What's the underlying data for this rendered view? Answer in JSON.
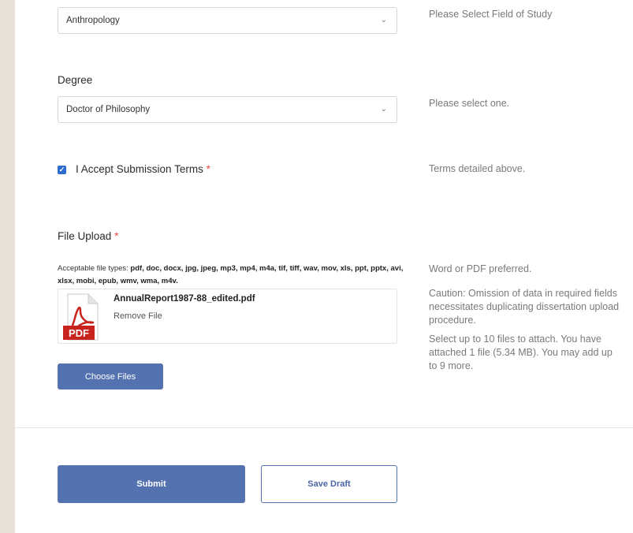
{
  "field_of_study": {
    "selected": "Anthropology",
    "help": "Please Select Field of Study"
  },
  "degree": {
    "label": "Degree",
    "selected": "Doctor of Philosophy",
    "help": "Please select one."
  },
  "terms": {
    "label": "I Accept Submission Terms",
    "required_mark": "*",
    "checked": true,
    "help": "Terms detailed above."
  },
  "file_upload": {
    "label": "File Upload",
    "required_mark": "*",
    "types_prefix": "Acceptable file types:",
    "types_list": "pdf, doc, docx, jpg, jpeg, mp3, mp4, m4a, tif, tiff, wav, mov, xls, ppt, pptx, avi, xlsx, mobi, epub, wmv, wma, m4v.",
    "file_name": "AnnualReport1987-88_edited.pdf",
    "remove_label": "Remove File",
    "file_icon_text": "PDF",
    "help_preferred": "Word or PDF preferred.",
    "help_caution": "Caution: Omission of data in required fields necessitates duplicating dissertation upload procedure.",
    "help_limit": "Select up to 10 files to attach. You have attached 1 file (5.34 MB). You may add up to 9 more.",
    "choose_label": "Choose Files"
  },
  "actions": {
    "submit_label": "Submit",
    "draft_label": "Save Draft"
  },
  "colors": {
    "accent": "#5472b0",
    "required": "#e04a4a",
    "pdf_red": "#c8231c"
  }
}
